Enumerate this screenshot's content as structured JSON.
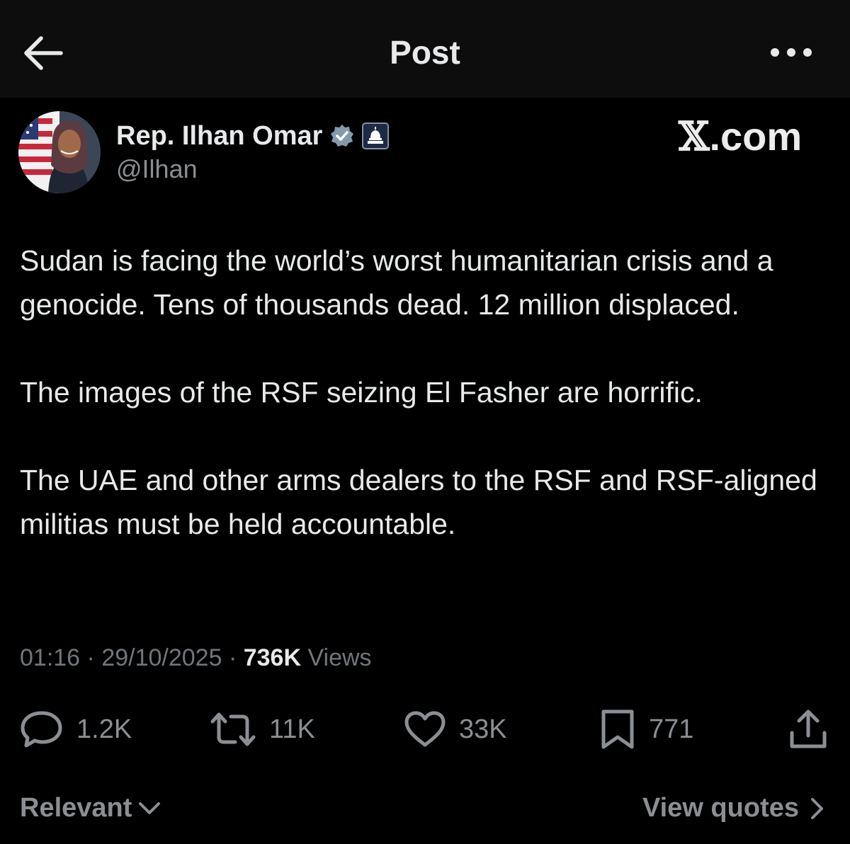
{
  "header": {
    "title": "Post",
    "back_icon": "arrow-left-icon",
    "more_icon": "more-horizontal-icon"
  },
  "author": {
    "display_name": "Rep. Ilhan Omar",
    "handle": "@Ilhan",
    "verified_icon": "verified-badge-icon",
    "affiliation_icon": "capitol-dome-icon"
  },
  "watermark": {
    "glyph": "𝕏",
    "text": ".com"
  },
  "post": {
    "paragraphs": [
      "Sudan is facing the world’s worst humanitarian crisis and a genocide. Tens of thousands dead. 12 million displaced.",
      "The images of the RSF seizing El Fasher are horrific.",
      "The UAE and other arms dealers to the RSF and RSF-aligned militias must be held accountable."
    ]
  },
  "meta": {
    "time": "01:16",
    "separator": "·",
    "date": "29/10/2025",
    "views_count": "736K",
    "views_label": "Views"
  },
  "actions": {
    "replies": {
      "icon": "reply-icon",
      "count": "1.2K"
    },
    "reposts": {
      "icon": "repost-icon",
      "count": "11K"
    },
    "likes": {
      "icon": "heart-icon",
      "count": "33K"
    },
    "bookmarks": {
      "icon": "bookmark-icon",
      "count": "771"
    },
    "share": {
      "icon": "share-icon"
    }
  },
  "footer": {
    "sort_label": "Relevant",
    "quotes_label": "View quotes"
  },
  "colors": {
    "background": "#000000",
    "header_background": "#0d0d0d",
    "text_primary": "#e7e9ea",
    "text_secondary": "#71767b",
    "verified_badge": "#829aab"
  }
}
